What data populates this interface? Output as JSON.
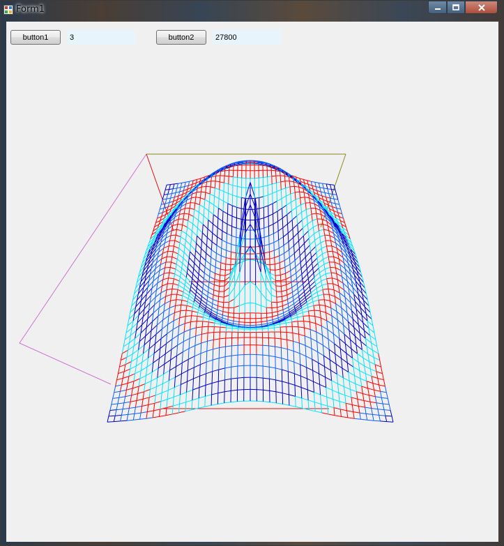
{
  "window": {
    "title": "Form1",
    "controls": [
      "minimize-icon",
      "maximize-icon",
      "close-icon"
    ]
  },
  "toolbar": {
    "button1_label": "button1",
    "textbox1_value": "3",
    "button2_label": "button2",
    "textbox2_value": "27800"
  },
  "plot": {
    "type": "3d wireframe surface",
    "colors": [
      "#0000c8",
      "#00e6ff",
      "#ff0000",
      "#1060ff"
    ]
  }
}
